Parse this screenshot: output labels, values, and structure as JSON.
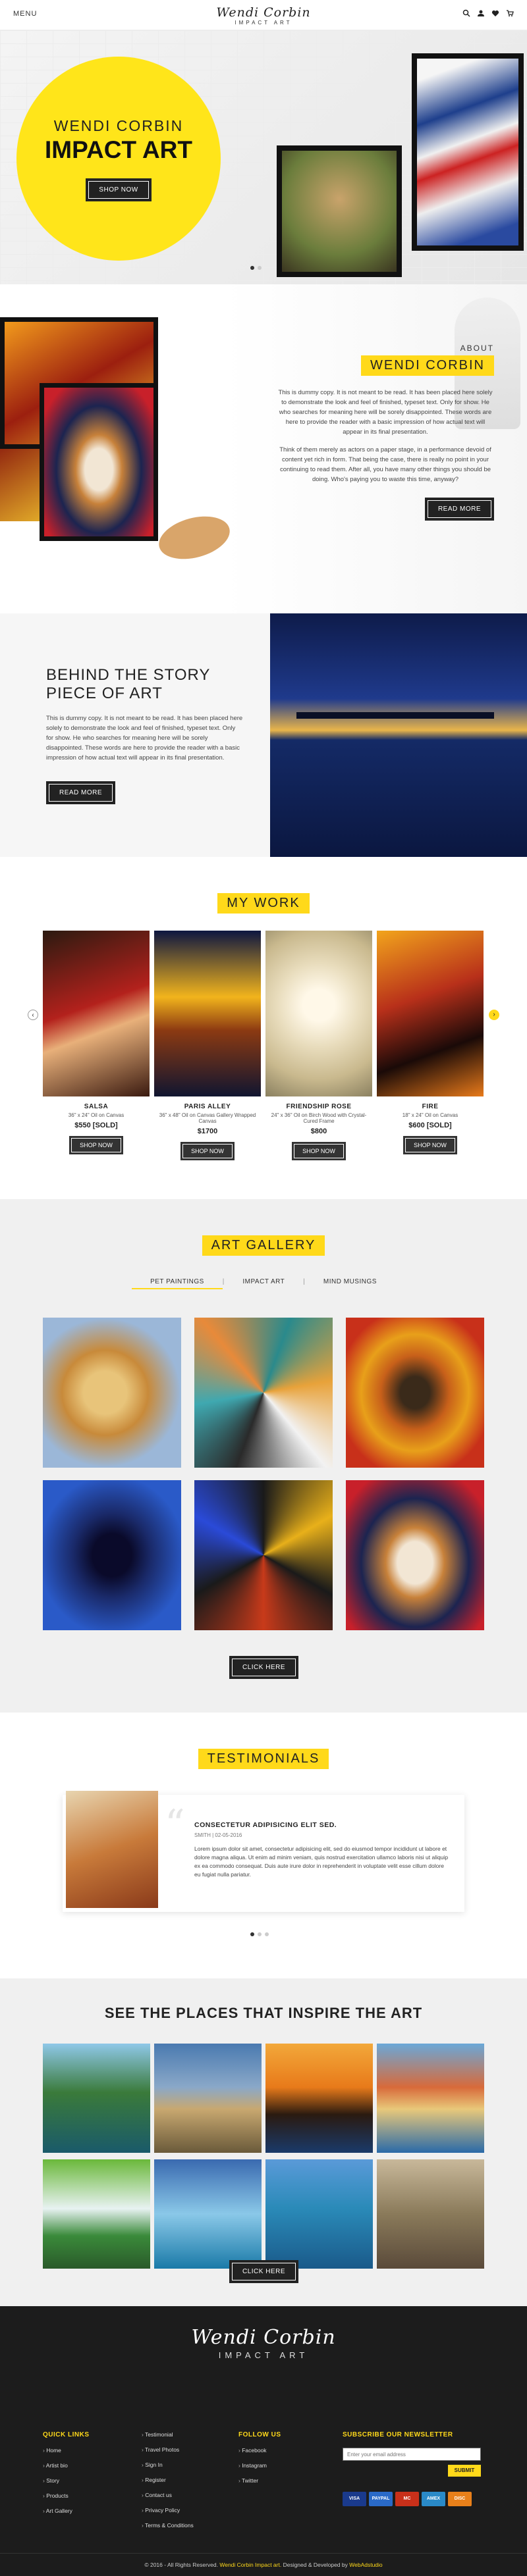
{
  "header": {
    "menu_label": "MENU",
    "logo_script": "Wendi Corbin",
    "logo_sub": "IMPACT ART"
  },
  "hero": {
    "line1": "WENDI CORBIN",
    "line2": "IMPACT ART",
    "button": "SHOP NOW"
  },
  "about": {
    "small": "ABOUT",
    "title": "WENDI CORBIN",
    "p1": "This is dummy copy. It is not meant to be read. It has been placed here solely to demonstrate the look and feel of finished, typeset text. Only for show. He who searches for meaning here will be sorely disappointed. These words are here to provide the reader with a basic impression of how actual text will appear in its final presentation.",
    "p2": "Think of them merely as actors on a paper stage, in a performance devoid of content yet rich in form. That being the case, there is really no point in your continuing to read them. After all, you have many other things you should be doing. Who's paying you to waste this time, anyway?",
    "button": "READ MORE"
  },
  "story": {
    "title1": "BEHIND THE STORY",
    "title2": "PIECE OF ART",
    "p": "This is dummy copy. It is not meant to be read. It has been placed here solely to demonstrate the look and feel of finished, typeset text. Only for show. He who searches for meaning here will be sorely disappointed. These words are here to provide the reader with a basic impression of how actual text will appear in its final presentation.",
    "button": "READ MORE"
  },
  "work": {
    "title": "MY WORK",
    "items": [
      {
        "title": "SALSA",
        "meta": "36\" x 24\" Oil on Canvas",
        "price": "$550 [SOLD]",
        "button": "SHOP NOW"
      },
      {
        "title": "PARIS ALLEY",
        "meta": "36\" x 48\" Oil on Canvas Gallery Wrapped Canvas",
        "price": "$1700",
        "button": "SHOP NOW"
      },
      {
        "title": "FRIENDSHIP ROSE",
        "meta": "24\" x 36\" Oil on Birch Wood with Crystal-Cured Frame",
        "price": "$800",
        "button": "SHOP NOW"
      },
      {
        "title": "FIRE",
        "meta": "18\" x 24\" Oil on Canvas",
        "price": "$600 [SOLD]",
        "button": "SHOP NOW"
      }
    ]
  },
  "gallery": {
    "title": "ART GALLERY",
    "tabs": [
      "PET PAINTINGS",
      "IMPACT ART",
      "MIND MUSINGS"
    ],
    "button": "CLICK HERE"
  },
  "testimonials": {
    "title": "TESTIMONIALS",
    "heading": "CONSECTETUR ADIPISICING ELIT SED.",
    "author": "SMITH",
    "date": "02-05-2016",
    "quote": "Lorem ipsum dolor sit amet, consectetur adipisicing elit, sed do eiusmod tempor incididunt ut labore et dolore magna aliqua. Ut enim ad minim veniam, quis nostrud exercitation ullamco laboris nisi ut aliquip ex ea commodo consequat. Duis aute irure dolor in reprehenderit in voluptate velit esse cillum dolore eu fugiat nulla pariatur."
  },
  "places": {
    "title": "SEE THE PLACES THAT INSPIRE THE ART",
    "button": "CLICK HERE"
  },
  "footer": {
    "logo_script": "Wendi Corbin",
    "logo_sub": "IMPACT ART",
    "quick_title": "QUICK LINKS",
    "quick": [
      "Home",
      "Artist bio",
      "Story",
      "Products",
      "Art Gallery"
    ],
    "col2": [
      "Testimonial",
      "Travel Photos",
      "Sign In",
      "Register",
      "Contact us",
      "Privacy Policy",
      "Terms & Conditions"
    ],
    "follow_title": "FOLLOW US",
    "follow": [
      "Facebook",
      "Instagram",
      "Twitter"
    ],
    "news_title": "SUBSCRIBE OUR NEWSLETTER",
    "news_placeholder": "Enter your email address",
    "news_button": "SUBMIT",
    "payments": [
      "VISA",
      "PAYPAL",
      "MC",
      "AMEX",
      "DISC"
    ],
    "copyright": "© 2016 - All Rights Reserved.",
    "copyright_brand": "Wendi Corbin Impact art.",
    "copyright_tail": "Designed & Developed by",
    "dev": "WebAdstudio"
  },
  "colors": {
    "accent": "#ffd91a",
    "dark": "#222222",
    "footer": "#1c1c1c"
  }
}
